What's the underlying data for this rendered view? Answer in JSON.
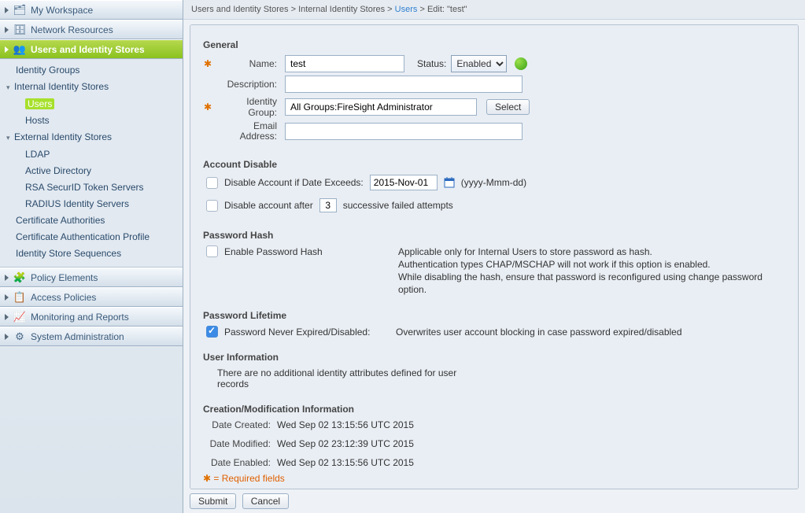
{
  "sidebar": {
    "top": [
      {
        "label": "My Workspace",
        "icon": "🗂"
      },
      {
        "label": "Network Resources",
        "icon": "🗄"
      }
    ],
    "selected": {
      "label": "Users and Identity Stores",
      "icon": "👥"
    },
    "tree": {
      "identity_groups": "Identity Groups",
      "internal": {
        "label": "Internal Identity Stores",
        "users": "Users",
        "hosts": "Hosts"
      },
      "external": {
        "label": "External Identity Stores",
        "ldap": "LDAP",
        "ad": "Active Directory",
        "rsa": "RSA SecurID Token Servers",
        "radius": "RADIUS Identity Servers"
      },
      "cert_auth": "Certificate Authorities",
      "cert_profile": "Certificate Authentication Profile",
      "seq": "Identity Store Sequences"
    },
    "bottom": [
      {
        "label": "Policy Elements",
        "icon": "🧩"
      },
      {
        "label": "Access Policies",
        "icon": "📋"
      },
      {
        "label": "Monitoring and Reports",
        "icon": "📈"
      },
      {
        "label": "System Administration",
        "icon": "⚙"
      }
    ]
  },
  "breadcrumb": {
    "a": "Users and Identity Stores",
    "b": "Internal Identity Stores",
    "c": "Users",
    "d": "Edit: \"test\""
  },
  "general": {
    "title": "General",
    "name_label": "Name:",
    "name_value": "test",
    "status_label": "Status:",
    "status_value": "Enabled",
    "desc_label": "Description:",
    "desc_value": "",
    "idgrp_label": "Identity Group:",
    "idgrp_value": "All Groups:FireSight Administrator",
    "select_btn": "Select",
    "email_label": "Email Address:",
    "email_value": ""
  },
  "acct_disable": {
    "title": "Account Disable",
    "exceeds_label": "Disable Account if Date Exceeds:",
    "exceeds_value": "2015-Nov-01",
    "exceeds_fmt": "(yyyy-Mmm-dd)",
    "after_a": "Disable account after",
    "after_value": "3",
    "after_b": "successive failed attempts"
  },
  "hash": {
    "title": "Password Hash",
    "cb_label": "Enable Password Hash",
    "note1": "Applicable only for Internal Users to store password as hash.",
    "note2": "Authentication types CHAP/MSCHAP will not work if this option is enabled.",
    "note3": "While disabling the hash, ensure that password is reconfigured using change password option."
  },
  "lifetime": {
    "title": "Password Lifetime",
    "cb_label": "Password Never Expired/Disabled:",
    "note": "Overwrites user account blocking in case password expired/disabled"
  },
  "userinfo": {
    "title": "User Information",
    "note": "There are no additional identity attributes defined for user records"
  },
  "cm": {
    "title": "Creation/Modification Information",
    "created_l": "Date Created:",
    "created_v": "Wed Sep 02 13:15:56 UTC 2015",
    "modified_l": "Date Modified:",
    "modified_v": "Wed Sep 02 23:12:39 UTC 2015",
    "enabled_l": "Date Enabled:",
    "enabled_v": "Wed Sep 02 13:15:56 UTC 2015"
  },
  "req_note": "= Required fields",
  "footer": {
    "submit": "Submit",
    "cancel": "Cancel"
  }
}
